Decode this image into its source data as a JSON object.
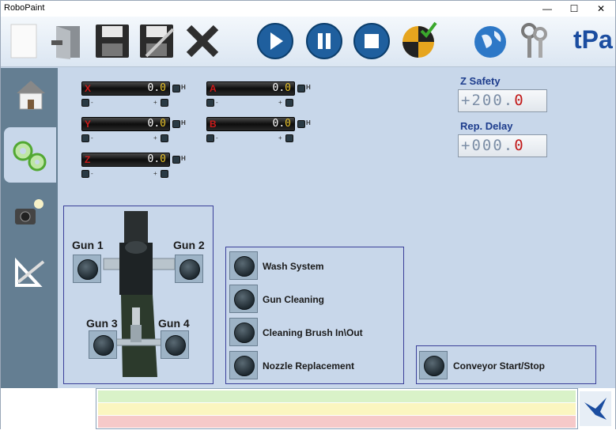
{
  "window": {
    "title": "RoboPaint",
    "minimize": "—",
    "maximize": "☐",
    "close": "✕"
  },
  "toolbar": {
    "buttons": [
      {
        "icon": "new-document-icon"
      },
      {
        "icon": "exit-door-icon"
      },
      {
        "icon": "save-icon"
      },
      {
        "icon": "save-as-icon"
      },
      {
        "icon": "delete-icon"
      },
      {
        "icon": "play-icon"
      },
      {
        "icon": "pause-icon"
      },
      {
        "icon": "stop-icon"
      },
      {
        "icon": "calibrate-icon"
      },
      {
        "icon": "globe-icon"
      },
      {
        "icon": "keys-icon"
      }
    ],
    "logo": "tPa"
  },
  "sidebar": {
    "tabs": [
      {
        "icon": "home-icon"
      },
      {
        "icon": "gears-icon",
        "active": true
      },
      {
        "icon": "camera-light-icon"
      },
      {
        "icon": "set-square-icon"
      }
    ]
  },
  "axes": [
    {
      "letter": "X",
      "int": "0.",
      "dec": "0",
      "h": "H",
      "minus": "-",
      "plus": "+"
    },
    {
      "letter": "Y",
      "int": "0.",
      "dec": "0",
      "h": "H",
      "minus": "-",
      "plus": "+"
    },
    {
      "letter": "Z",
      "int": "0.",
      "dec": "0",
      "h": "H",
      "minus": "-",
      "plus": "+"
    },
    {
      "letter": "A",
      "int": "0.",
      "dec": "0",
      "h": "H",
      "minus": "-",
      "plus": "+"
    },
    {
      "letter": "B",
      "int": "0.",
      "dec": "0",
      "h": "H",
      "minus": "-",
      "plus": "+"
    }
  ],
  "z_safety": {
    "label": "Z Safety",
    "int": "+200.",
    "dec": "0"
  },
  "rep_delay": {
    "label": "Rep. Delay",
    "int": "+000.",
    "dec": "0"
  },
  "guns": {
    "gun1": "Gun 1",
    "gun2": "Gun 2",
    "gun3": "Gun 3",
    "gun4": "Gun 4"
  },
  "wash": {
    "items": [
      "Wash System",
      "Gun Cleaning",
      "Cleaning Brush In\\Out",
      "Nozzle Replacement"
    ]
  },
  "conveyor": {
    "label": "Conveyor Start/Stop"
  },
  "status": {
    "colors": [
      "#d9f2c8",
      "#fbf6c0",
      "#f6c9c9"
    ]
  }
}
